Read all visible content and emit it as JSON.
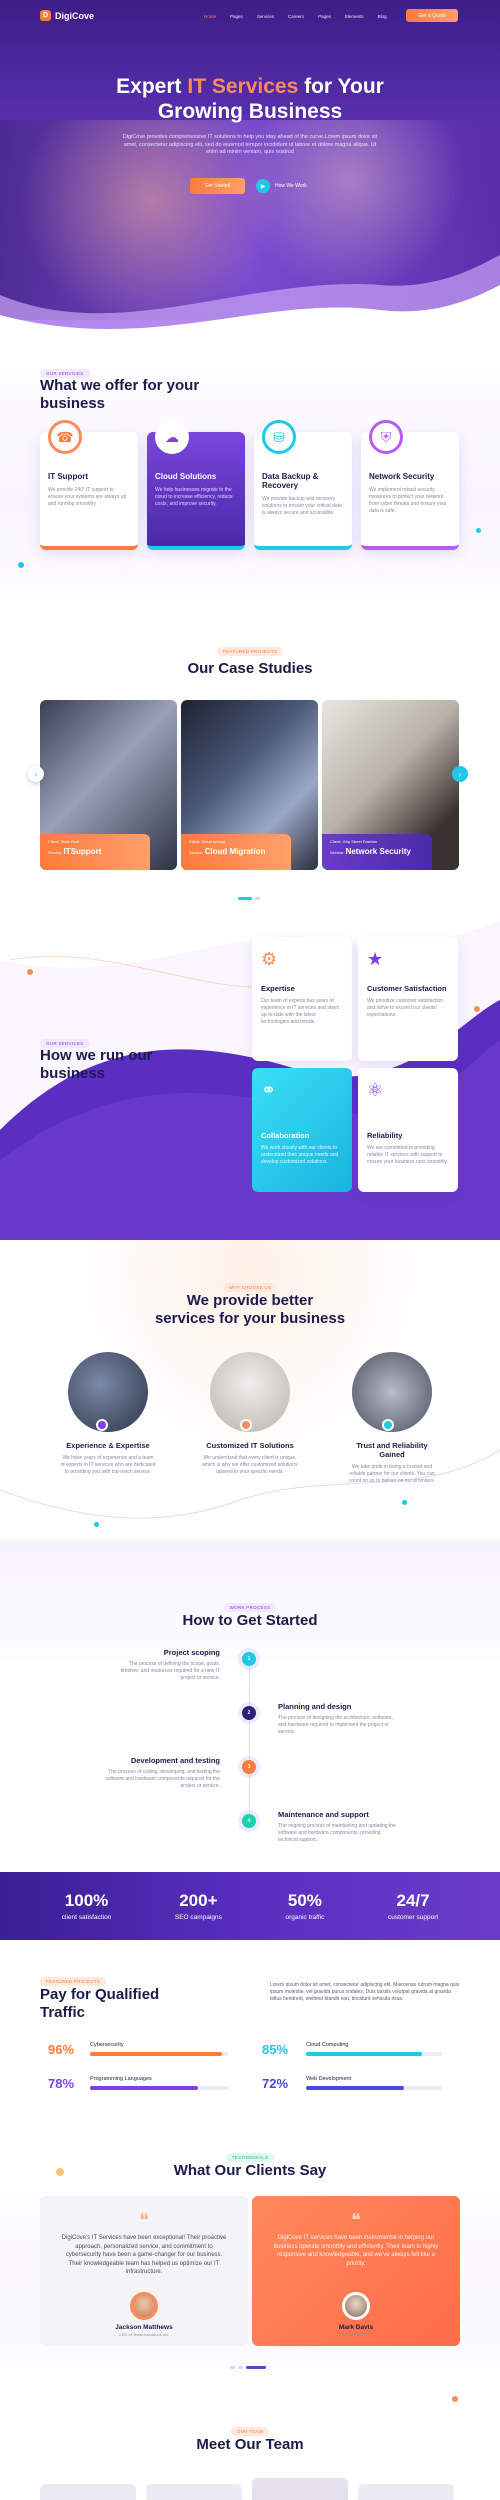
{
  "brand": {
    "logo_letter": "D",
    "name": "DigiCove"
  },
  "nav": {
    "items": [
      "Home",
      "Pages",
      "Services",
      "Careers",
      "Pages",
      "Elements",
      "Blog"
    ],
    "cta": "Get a Quote"
  },
  "hero": {
    "title_1": "Expert ",
    "title_accent": "IT Services",
    "title_2": " for Your",
    "title_3": "Growing Business",
    "text": "DigiCove provides comprehensive IT solutions to help you stay ahead of the curve.Lorem ipsum dolor sit amet, consectetur adipiscing elit, sed do eiusmod tempor incididunt ut labore et dolore magna aliqua. Ut enim ad minim veniam, quis nostrud",
    "cta": "Get Started",
    "watch": "How We Work"
  },
  "offer": {
    "tag": "Our Services",
    "title_1": "What we offer for your",
    "title_2": "business",
    "cards": [
      {
        "title": "IT Support",
        "text": "We provide 24/7 IT support to ensure your systems are always up and running smoothly.",
        "icon": "headset-icon"
      },
      {
        "title": "Cloud Solutions",
        "text": "We help businesses migrate to the cloud to increase efficiency, reduce costs, and improve security.",
        "icon": "cloud-icon"
      },
      {
        "title": "Data Backup & Recovery",
        "text": "We provide backup and recovery solutions to ensure your critical data is always secure and accessible.",
        "icon": "database-icon"
      },
      {
        "title": "Network Security",
        "text": "We implement robust security measures to protect your network from cyber threats and ensure your data is safe.",
        "icon": "shield-icon"
      }
    ]
  },
  "cases": {
    "tag": "Featured Projects",
    "title": "Our Case Studies",
    "items": [
      {
        "client_label": "Client:",
        "client": "Tesla Stuff",
        "service_label": "Service:",
        "service": "ITSupport"
      },
      {
        "client_label": "Client:",
        "client": "Cloud surfing",
        "service_label": "Service:",
        "service": "Cloud Migration"
      },
      {
        "client_label": "Client:",
        "client": "Grip Street Fashion",
        "service_label": "Service:",
        "service": "Network Security"
      }
    ]
  },
  "process": {
    "tag": "Our Services",
    "title_1": "How we run our",
    "title_2": "business",
    "cards": [
      {
        "title": "Expertise",
        "text": "Our team of experts has years of experience in IT services and stays up-to-date with the latest technologies and trends."
      },
      {
        "title": "Customer Satisfaction",
        "text": "We prioritize customer satisfaction and strive to exceed our clients' expectations."
      },
      {
        "title": "Collaboration",
        "text": "We work closely with our clients to understand their unique needs and develop customized solutions."
      },
      {
        "title": "Reliability",
        "text": "We are committed to providing reliable IT services with support to ensure your business runs smoothly."
      }
    ]
  },
  "why": {
    "tag": "Why Choose Us",
    "title_1": "We provide better",
    "title_2": "services for your business",
    "items": [
      {
        "title": "Experience & Expertise",
        "text": "We have years of experience and a team of experts in IT services who are dedicated to providing you with top-notch service."
      },
      {
        "title": "Customized IT Solutions",
        "text": "We understand that every client is unique, which is why we offer customized solutions tailored to your specific needs."
      },
      {
        "title": "Trust and Reliability Gained",
        "text": "We take pride in being a trusted and reliable partner for our clients. You can count on us to deliver on our promises."
      }
    ]
  },
  "steps": {
    "tag": "Work Process",
    "title": "How to Get Started",
    "items": [
      {
        "num": "1",
        "title": "Project scoping",
        "text": "The process of defining the scope, goals, timeline, and resources required for a new IT project or service."
      },
      {
        "num": "2",
        "title": "Planning and design",
        "text": "The process of designing the architecture, software, and hardware required to implement the project or service."
      },
      {
        "num": "3",
        "title": "Development and testing",
        "text": "The process of coding, developing, and testing the software and hardware components required for the project or service."
      },
      {
        "num": "4",
        "title": "Maintenance and support",
        "text": "The ongoing process of maintaining and updating the software and hardware components, providing technical support."
      }
    ]
  },
  "stats": [
    {
      "value": "100%",
      "label": "client satisfaction"
    },
    {
      "value": "200+",
      "label": "SEO campaigns"
    },
    {
      "value": "50%",
      "label": "organic traffic"
    },
    {
      "value": "24/7",
      "label": "customer support"
    }
  ],
  "skills": {
    "tag": "Featured Projects",
    "title_1": "Pay for Qualified",
    "title_2": "Traffic",
    "text": "Lorem ipsum dolor sit amet, consectetur adipiscing elit. Maecenas rutrum magna quis ipsum molestie, vel gravida purus sodales. Duis iaculis volutpat gravida at gravida tellus hendrerit, eleifend blandit non, tincidunt vehicula risus.",
    "items": [
      {
        "percent": "96%",
        "label": "Cybersecurity",
        "fill": 0.96,
        "color": "#ff7a3d"
      },
      {
        "percent": "85%",
        "label": "Cloud Computing",
        "fill": 0.85,
        "color": "#1ec9e8"
      },
      {
        "percent": "78%",
        "label": "Programming Languages",
        "fill": 0.78,
        "color": "#7b3fe4"
      },
      {
        "percent": "72%",
        "label": "Web Development",
        "fill": 0.72,
        "color": "#4a4ad8"
      }
    ]
  },
  "testimonials": {
    "tag": "Testimonials",
    "title": "What Our Clients Say",
    "items": [
      {
        "quote": "DigiCove's IT Services have been exceptional! Their proactive approach, personalized service, and commitment to cybersecurity have been a game-changer for our business. Their knowledgeable team has helped us optimize our IT infrastructure.",
        "name": "Jackson Matthews",
        "role": "CEO of TechInnovations Inc."
      },
      {
        "quote": "DigiCove IT services have been instrumental in helping our business operate smoothly and efficiently. Their team is highly responsive and knowledgeable, and we've always felt like a priority.",
        "name": "Mark Davis",
        "role": "CEO of Data Ecor"
      }
    ]
  },
  "team": {
    "tag": "Our Team",
    "title": "Meet Our Team"
  },
  "colors": {
    "primary": "#6b3cc9",
    "accent": "#ff7a3d",
    "cyan": "#1ec9e8",
    "dark": "#1c1b4b"
  }
}
